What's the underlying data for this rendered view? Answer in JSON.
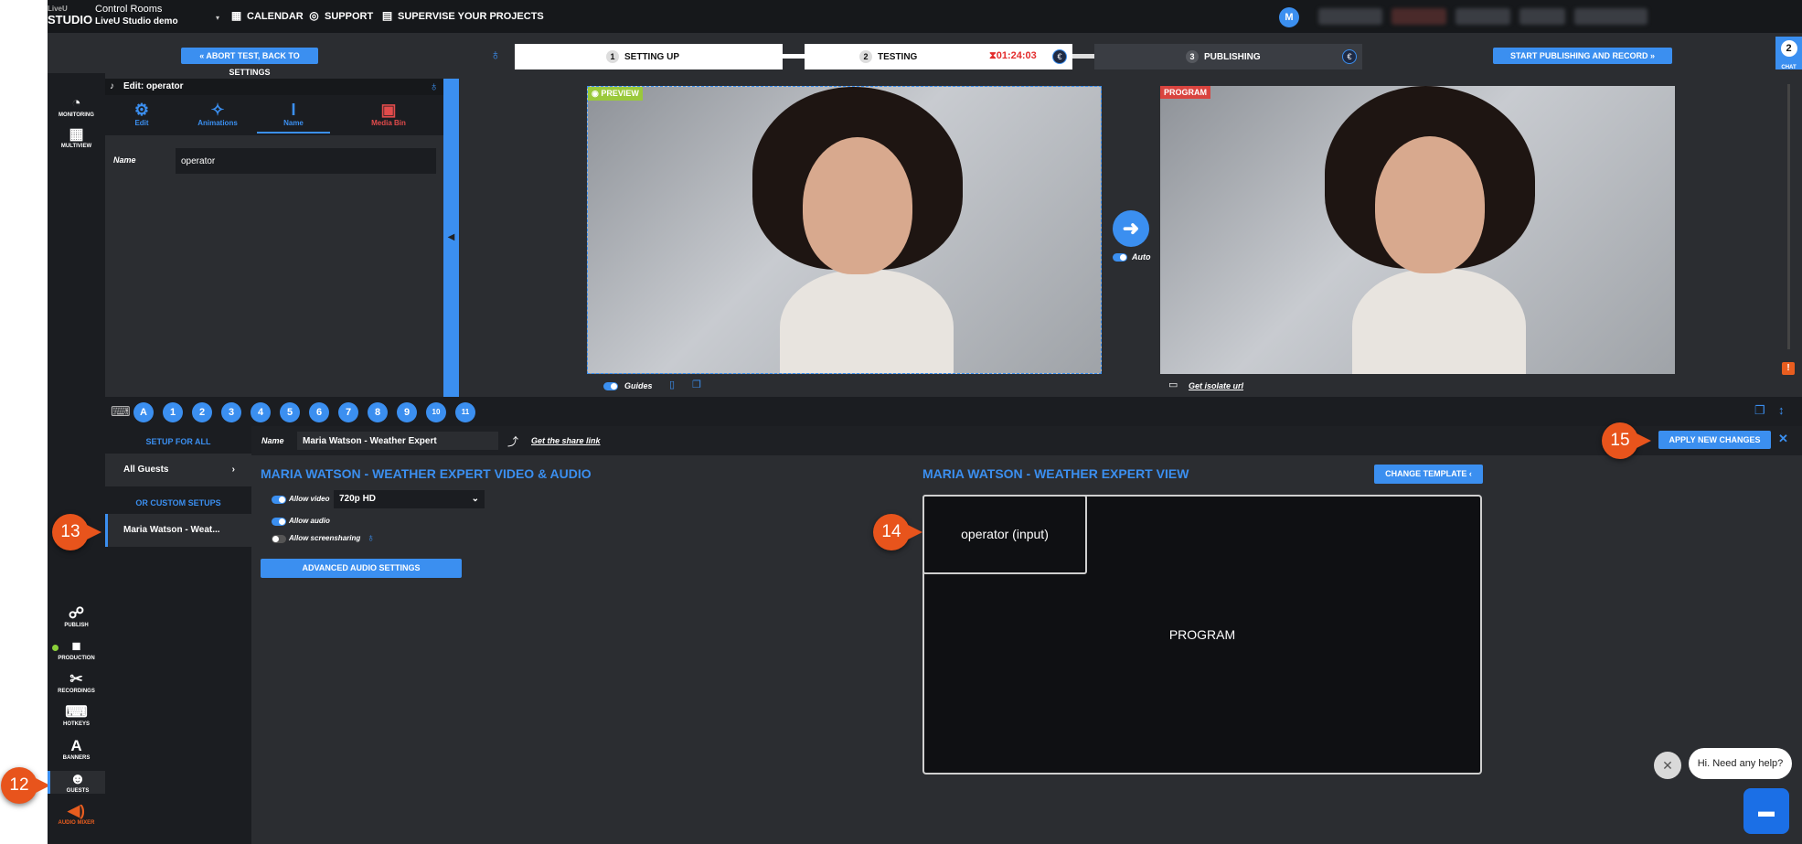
{
  "topnav": {
    "logo_top": "LiveU",
    "logo_main": "STUDIO",
    "room_label": "Control Rooms",
    "room_name": "LiveU Studio demo",
    "calendar": "CALENDAR",
    "support": "SUPPORT",
    "supervise": "SUPERVISE YOUR PROJECTS",
    "avatar_initial": "M"
  },
  "stepbar": {
    "abort_label": "« ABORT TEST, BACK TO SETTINGS",
    "step1_num": "1",
    "step1_label": "SETTING UP",
    "step2_num": "2",
    "step2_label": "TESTING",
    "timer": "⧗01:24:03",
    "step3_num": "3",
    "step3_label": "PUBLISHING",
    "start_label": "START PUBLISHING AND RECORD »",
    "euro": "€",
    "chat_count": "2",
    "chat_label": "CHAT"
  },
  "sidebar": {
    "monitoring": "MONITORING",
    "multiview": "MULTIVIEW",
    "publish": "PUBLISH",
    "production": "PRODUCTION",
    "recordings": "RECORDINGS",
    "hotkeys": "HOTKEYS",
    "banners": "BANNERS",
    "guests": "GUESTS",
    "audio_mixer": "AUDIO MIXER",
    "guests_letter": "A"
  },
  "edit_panel": {
    "header": "Edit: operator",
    "tab_edit": "Edit",
    "tab_animations": "Animations",
    "tab_name": "Name",
    "tab_media_bin": "Media Bin",
    "name_label": "Name",
    "name_value": "operator"
  },
  "video": {
    "preview_label": "PREVIEW",
    "program_label": "PROGRAM",
    "auto_label": "Auto",
    "guides_label": "Guides",
    "isolate_link": "Get isolate url"
  },
  "keys": [
    "A",
    "1",
    "2",
    "3",
    "4",
    "5",
    "6",
    "7",
    "8",
    "9",
    "10",
    "11"
  ],
  "guests_setup": {
    "setup_for_all": "SETUP FOR ALL",
    "all_guests": "All Guests",
    "or_custom": "OR CUSTOM SETUPS",
    "custom_item": "Maria Watson - Weat...",
    "name_label": "Name",
    "name_value": "Maria Watson - Weather Expert",
    "share_link": "Get the share link",
    "apply_label": "APPLY NEW CHANGES",
    "av_heading": "MARIA WATSON - WEATHER EXPERT VIDEO & AUDIO",
    "allow_video": "Allow video",
    "video_quality": "720p HD",
    "allow_audio": "Allow audio",
    "allow_screensharing": "Allow screensharing",
    "advanced_audio": "ADVANCED AUDIO SETTINGS",
    "view_heading": "MARIA WATSON - WEATHER EXPERT VIEW",
    "change_template": "CHANGE TEMPLATE ‹",
    "input_box": "operator (input)",
    "program_box": "PROGRAM"
  },
  "callouts": {
    "c12": "12",
    "c13": "13",
    "c14": "14",
    "c15": "15"
  },
  "help": {
    "bubble": "Hi. Need any help?"
  },
  "colors": {
    "accent": "#3b8ff0",
    "danger": "#e14b4b",
    "callout": "#e8541c",
    "ok": "#8bd03a"
  }
}
